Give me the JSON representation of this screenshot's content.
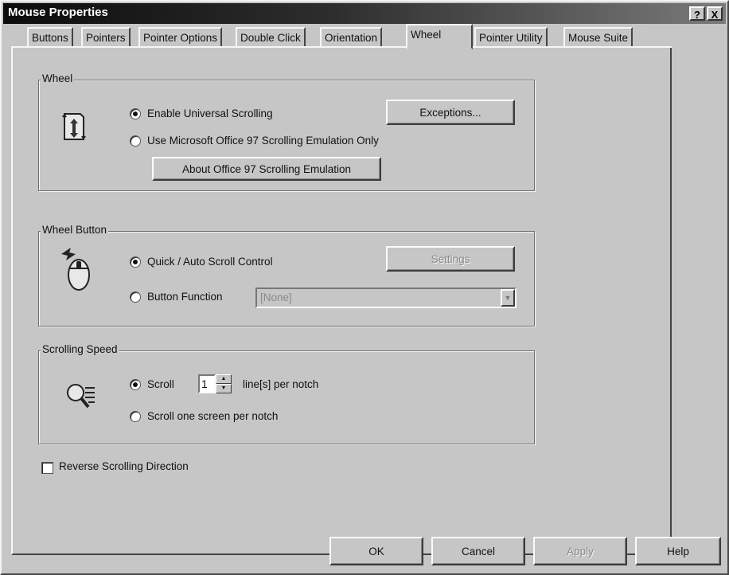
{
  "window": {
    "title": "Mouse Properties",
    "help_button": "?",
    "close_button": "X"
  },
  "tabs": [
    {
      "label": "Buttons"
    },
    {
      "label": "Pointers"
    },
    {
      "label": "Pointer Options"
    },
    {
      "label": "Double Click"
    },
    {
      "label": "Orientation"
    },
    {
      "label": "Wheel"
    },
    {
      "label": "Pointer Utility"
    },
    {
      "label": "Mouse Suite"
    }
  ],
  "active_tab": "Wheel",
  "wheel_group": {
    "label": "Wheel",
    "enable_universal": {
      "label": "Enable Universal Scrolling",
      "checked": true
    },
    "office97_only": {
      "label": "Use Microsoft Office 97 Scrolling Emulation Only",
      "checked": false
    },
    "exceptions_button": "Exceptions...",
    "about_button": "About Office 97 Scrolling Emulation"
  },
  "wheel_button_group": {
    "label": "Wheel Button",
    "quick_auto": {
      "label": "Quick / Auto Scroll Control",
      "checked": true
    },
    "button_function": {
      "label": "Button Function",
      "checked": false
    },
    "settings_button": "Settings",
    "function_select_value": "[None]"
  },
  "scrolling_speed_group": {
    "label": "Scrolling Speed",
    "scroll_lines": {
      "label": "Scroll",
      "checked": true
    },
    "lines_value": "1",
    "lines_suffix": "line[s] per notch",
    "scroll_screen": {
      "label": "Scroll one screen per notch",
      "checked": false
    }
  },
  "reverse_scrolling": {
    "label": "Reverse Scrolling Direction",
    "checked": false
  },
  "footer": {
    "ok": "OK",
    "cancel": "Cancel",
    "apply": "Apply",
    "help": "Help"
  }
}
